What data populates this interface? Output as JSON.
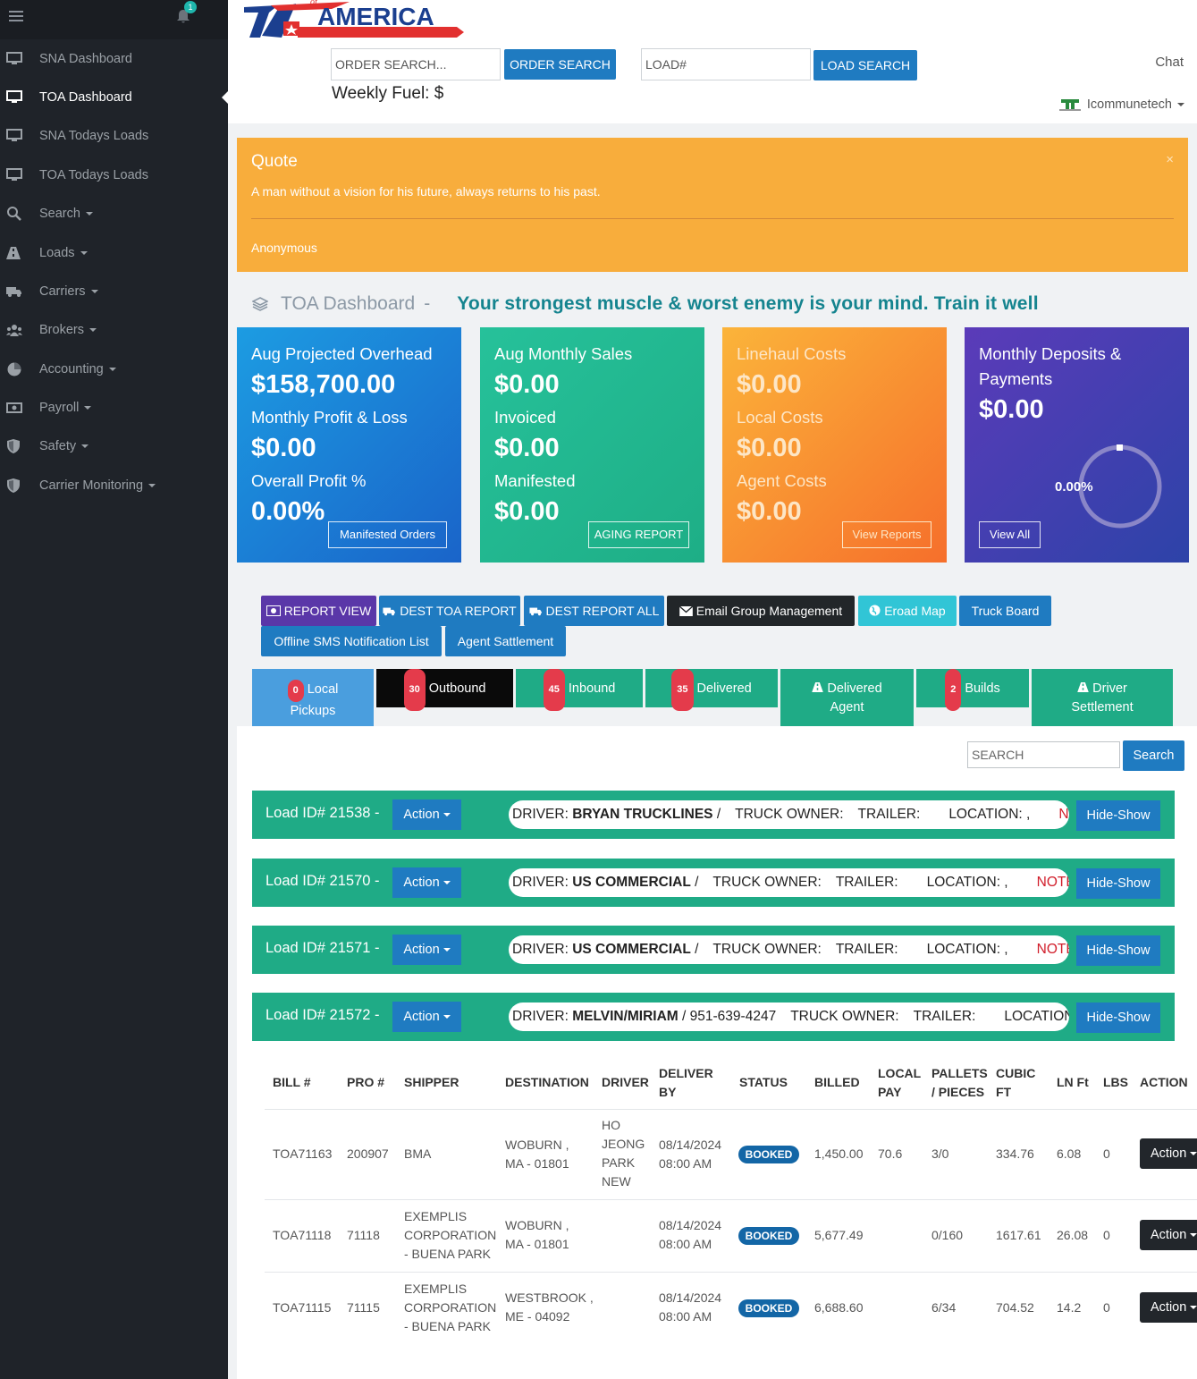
{
  "brand": {
    "logo_text": "AMERICA",
    "logo_small": "of",
    "logo_red": "#e2302f",
    "logo_blue": "#1b3f8f"
  },
  "notifications": {
    "count": "1"
  },
  "sidebar": {
    "items": [
      {
        "label": "SNA Dashboard",
        "icon": "monitor-icon"
      },
      {
        "label": "TOA Dashboard",
        "icon": "monitor-icon"
      },
      {
        "label": "SNA Todays Loads",
        "icon": "monitor-icon"
      },
      {
        "label": "TOA Todays Loads",
        "icon": "monitor-icon"
      },
      {
        "label": "Search",
        "icon": "search-icon"
      },
      {
        "label": "Loads",
        "icon": "road-icon"
      },
      {
        "label": "Carriers",
        "icon": "truck-icon"
      },
      {
        "label": "Brokers",
        "icon": "users-icon"
      },
      {
        "label": "Accounting",
        "icon": "pie-chart-icon"
      },
      {
        "label": "Payroll",
        "icon": "money-icon"
      },
      {
        "label": "Safety",
        "icon": "shield-icon"
      },
      {
        "label": "Carrier Monitoring",
        "icon": "shield-icon"
      }
    ]
  },
  "header": {
    "order_search_placeholder": "ORDER SEARCH...",
    "order_search_button": "ORDER SEARCH",
    "load_placeholder": "LOAD#",
    "load_search_button": "LOAD SEARCH",
    "weekly_fuel": "Weekly Fuel: $",
    "chat": "Chat",
    "user": "Icommunetech"
  },
  "quote": {
    "title": "Quote",
    "text": "A man without a vision for his future, always returns to his past.",
    "author": "Anonymous",
    "close": "×"
  },
  "dashboard": {
    "title": "TOA Dashboard",
    "separator": "-",
    "motto": "Your strongest muscle & worst enemy is your mind. Train it well"
  },
  "cards": [
    {
      "l1": "Aug Projected Overhead",
      "v1": "$158,700.00",
      "l2": "Monthly Profit & Loss",
      "v2": "$0.00",
      "l3": "Overall Profit %",
      "v3": "0.00%",
      "button": "Manifested Orders"
    },
    {
      "l1": "Aug Monthly Sales",
      "v1": "$0.00",
      "l2": "Invoiced",
      "v2": "$0.00",
      "l3": "Manifested",
      "v3": "$0.00",
      "button": "AGING REPORT"
    },
    {
      "l1": "Linehaul Costs",
      "v1": "$0.00",
      "l2": "Local Costs",
      "v2": "$0.00",
      "l3": "Agent Costs",
      "v3": "$0.00",
      "button": "View Reports"
    },
    {
      "l1a": "Monthly Deposits &",
      "l1b": "Payments",
      "v1": "$0.00",
      "gauge": "0.00%",
      "gauge_value": 0,
      "button": "View All"
    }
  ],
  "actions": [
    {
      "label": "REPORT VIEW",
      "icon": "report-icon",
      "color": "#5a37a8"
    },
    {
      "label": "DEST TOA REPORT",
      "icon": "truck-icon",
      "color": "#1f7bc1"
    },
    {
      "label": "DEST REPORT ALL",
      "icon": "truck-icon",
      "color": "#1f7bc1"
    },
    {
      "label": "Email Group Management",
      "icon": "envelope-icon",
      "color": "#222629"
    },
    {
      "label": "Eroad Map",
      "icon": "globe-icon",
      "color": "#31c5d6"
    },
    {
      "label": "Truck Board",
      "icon": "",
      "color": "#1f7bc1"
    },
    {
      "label": "Offline SMS Notification List",
      "icon": "",
      "color": "#1f7bc1"
    },
    {
      "label": "Agent Sattlement",
      "icon": "",
      "color": "#1f7bc1"
    }
  ],
  "tabs": [
    {
      "count": "0",
      "label": "Local",
      "label2": "Pickups",
      "color": "#4a9ede"
    },
    {
      "count": "30",
      "label": "Outbound",
      "color": "#0a0a0a"
    },
    {
      "count": "45",
      "label": "Inbound",
      "color": "#1fab86"
    },
    {
      "count": "35",
      "label": "Delivered",
      "color": "#1fab86"
    },
    {
      "label": "Delivered",
      "label2": "Agent",
      "color": "#1fab86"
    },
    {
      "count": "2",
      "label": "Builds",
      "color": "#1fab86"
    },
    {
      "label": "Driver",
      "label2": "Settlement",
      "color": "#1fab86"
    }
  ],
  "search": {
    "placeholder": "SEARCH",
    "button": "Search"
  },
  "loads": [
    {
      "id": "Load ID# 21538 -",
      "action": "Action",
      "driver_label": "DRIVER:",
      "driver": "BRYAN TRUCKLINES",
      "phone": "/",
      "truck_owner": "TRUCK OWNER:",
      "trailer": "TRAILER:",
      "location": "LOCATION: ,",
      "note": "NOTE:",
      "toggle": "Hide-Show"
    },
    {
      "id": "Load ID# 21570 -",
      "action": "Action",
      "driver_label": "DRIVER:",
      "driver": "US COMMERCIAL",
      "phone": "/",
      "truck_owner": "TRUCK OWNER:",
      "trailer": "TRAILER:",
      "location": "LOCATION: ,",
      "note": "NOTE:",
      "toggle": "Hide-Show"
    },
    {
      "id": "Load ID# 21571 -",
      "action": "Action",
      "driver_label": "DRIVER:",
      "driver": "US COMMERCIAL",
      "phone": "/",
      "truck_owner": "TRUCK OWNER:",
      "trailer": "TRAILER:",
      "location": "LOCATION: ,",
      "note": "NOTE:",
      "toggle": "Hide-Show"
    },
    {
      "id": "Load ID# 21572 -",
      "action": "Action",
      "driver_label": "DRIVER:",
      "driver": "MELVIN/MIRIAM",
      "phone": "/ 951-639-4247",
      "truck_owner": "TRUCK OWNER:",
      "trailer": "TRAILER:",
      "location": "LOCATION: ,",
      "note": "",
      "toggle": "Hide-Show"
    }
  ],
  "table": {
    "headers": [
      "BILL #",
      "PRO #",
      "SHIPPER",
      "DESTINATION",
      "DRIVER",
      "DELIVER BY",
      "STATUS",
      "BILLED",
      "LOCAL PAY",
      "PALLETS / PIECES",
      "CUBIC FT",
      "LN Ft",
      "LBS",
      "ACTION"
    ],
    "rows": [
      {
        "bill": "TOA71163",
        "pro": "200907",
        "shipper": "BMA",
        "destination": "WOBURN , MA - 01801",
        "driver": "HO JEONG PARK NEW",
        "deliver_by": "08/14/2024 08:00 AM",
        "status": "BOOKED",
        "billed": "1,450.00",
        "local_pay": "70.6",
        "pallets": "3/0",
        "cubic": "334.76",
        "lnft": "6.08",
        "lbs": "0",
        "action": "Action"
      },
      {
        "bill": "TOA71118",
        "pro": "71118",
        "shipper": "EXEMPLIS CORPORATION - BUENA PARK",
        "destination": "WOBURN , MA - 01801",
        "driver": "",
        "deliver_by": "08/14/2024 08:00 AM",
        "status": "BOOKED",
        "billed": "5,677.49",
        "local_pay": "",
        "pallets": "0/160",
        "cubic": "1617.61",
        "lnft": "26.08",
        "lbs": "0",
        "action": "Action"
      },
      {
        "bill": "TOA71115",
        "pro": "71115",
        "shipper": "EXEMPLIS CORPORATION - BUENA PARK",
        "destination": "WESTBROOK , ME - 04092",
        "driver": "",
        "deliver_by": "08/14/2024 08:00 AM",
        "status": "BOOKED",
        "billed": "6,688.60",
        "local_pay": "",
        "pallets": "6/34",
        "cubic": "704.52",
        "lnft": "14.2",
        "lbs": "0",
        "action": "Action"
      }
    ]
  }
}
